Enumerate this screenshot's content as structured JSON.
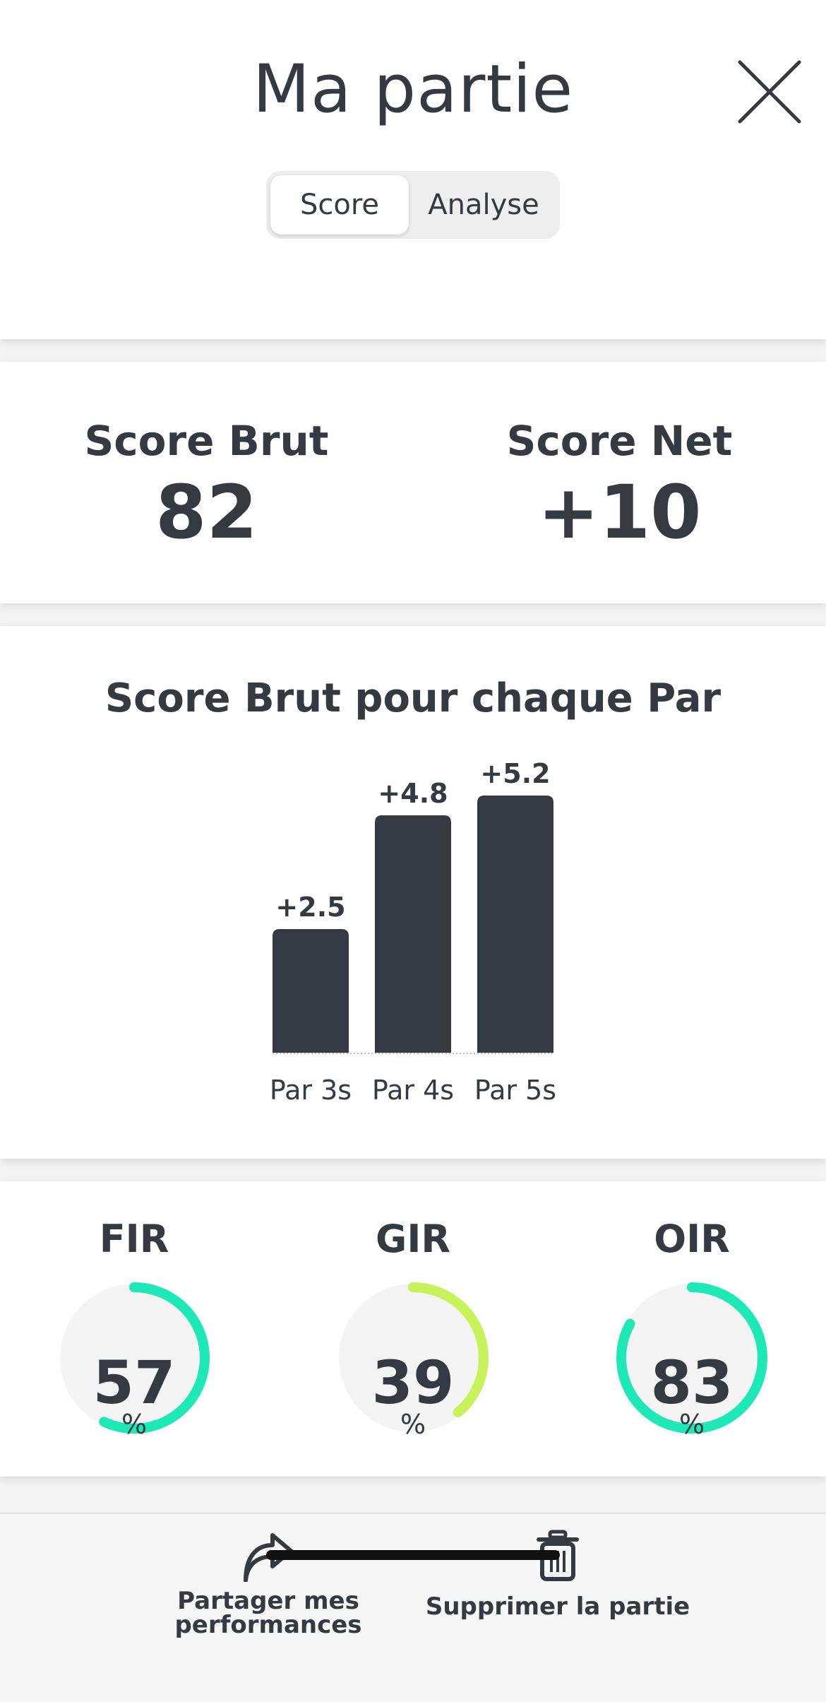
{
  "header": {
    "title": "Ma partie",
    "tabs": [
      {
        "label": "Score",
        "active": true
      },
      {
        "label": "Analyse",
        "active": false
      }
    ]
  },
  "scores": {
    "brut_label": "Score Brut",
    "brut_value": "82",
    "net_label": "Score Net",
    "net_value": "+10"
  },
  "chart_data": {
    "type": "bar",
    "title": "Score Brut pour chaque Par",
    "categories": [
      "Par 3s",
      "Par 4s",
      "Par 5s"
    ],
    "values": [
      2.5,
      4.8,
      5.2
    ],
    "value_labels": [
      "+2.5",
      "+4.8",
      "+5.2"
    ],
    "bar_color": "#353a42",
    "ylim": [
      0,
      5.2
    ]
  },
  "stats": [
    {
      "label": "FIR",
      "value": "57",
      "unit": "%",
      "percent": 57,
      "color": "#1de9b6"
    },
    {
      "label": "GIR",
      "value": "39",
      "unit": "%",
      "percent": 39,
      "color": "#c6f25a"
    },
    {
      "label": "OIR",
      "value": "83",
      "unit": "%",
      "percent": 83,
      "color": "#1de9b6"
    }
  ],
  "actions": {
    "share_line1": "Partager mes",
    "share_line2": "performances",
    "delete_label": "Supprimer la partie"
  },
  "icons": {
    "close": "close-icon",
    "share": "share-arrow-icon",
    "delete": "trash-icon"
  }
}
